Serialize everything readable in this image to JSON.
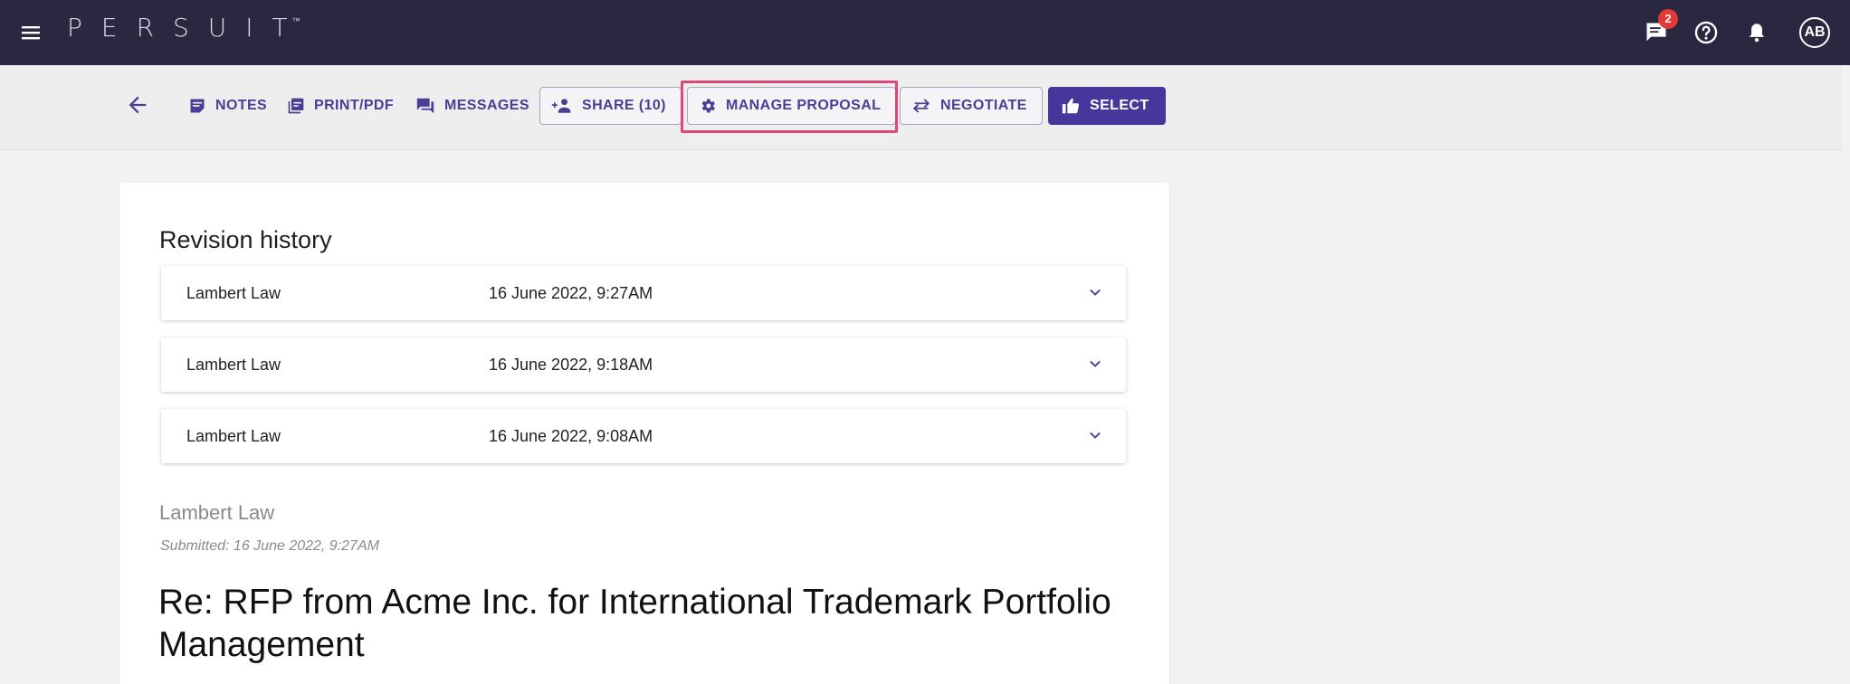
{
  "app": {
    "logo": "PERSUIT",
    "logo_tm": "™",
    "messages_badge": "2",
    "avatar_initials": "AB"
  },
  "toolbar": {
    "notes_label": "NOTES",
    "print_label": "PRINT/PDF",
    "messages_label": "MESSAGES",
    "share_label": "SHARE (10)",
    "manage_label": "MANAGE PROPOSAL",
    "negotiate_label": "NEGOTIATE",
    "select_label": "SELECT"
  },
  "revision_history": {
    "title": "Revision history",
    "rows": [
      {
        "author": "Lambert Law",
        "date": "16 June 2022, 9:27AM"
      },
      {
        "author": "Lambert Law",
        "date": "16 June 2022, 9:18AM"
      },
      {
        "author": "Lambert Law",
        "date": "16 June 2022, 9:08AM"
      }
    ]
  },
  "proposal": {
    "firm": "Lambert Law",
    "submitted": "Submitted: 16 June 2022, 9:27AM",
    "heading": "Re: RFP from Acme Inc. for International Trademark Portfolio Management"
  },
  "colors": {
    "appbar": "#2a2840",
    "accent": "#46389a",
    "highlight": "#e0457b",
    "badge": "#e53935"
  }
}
